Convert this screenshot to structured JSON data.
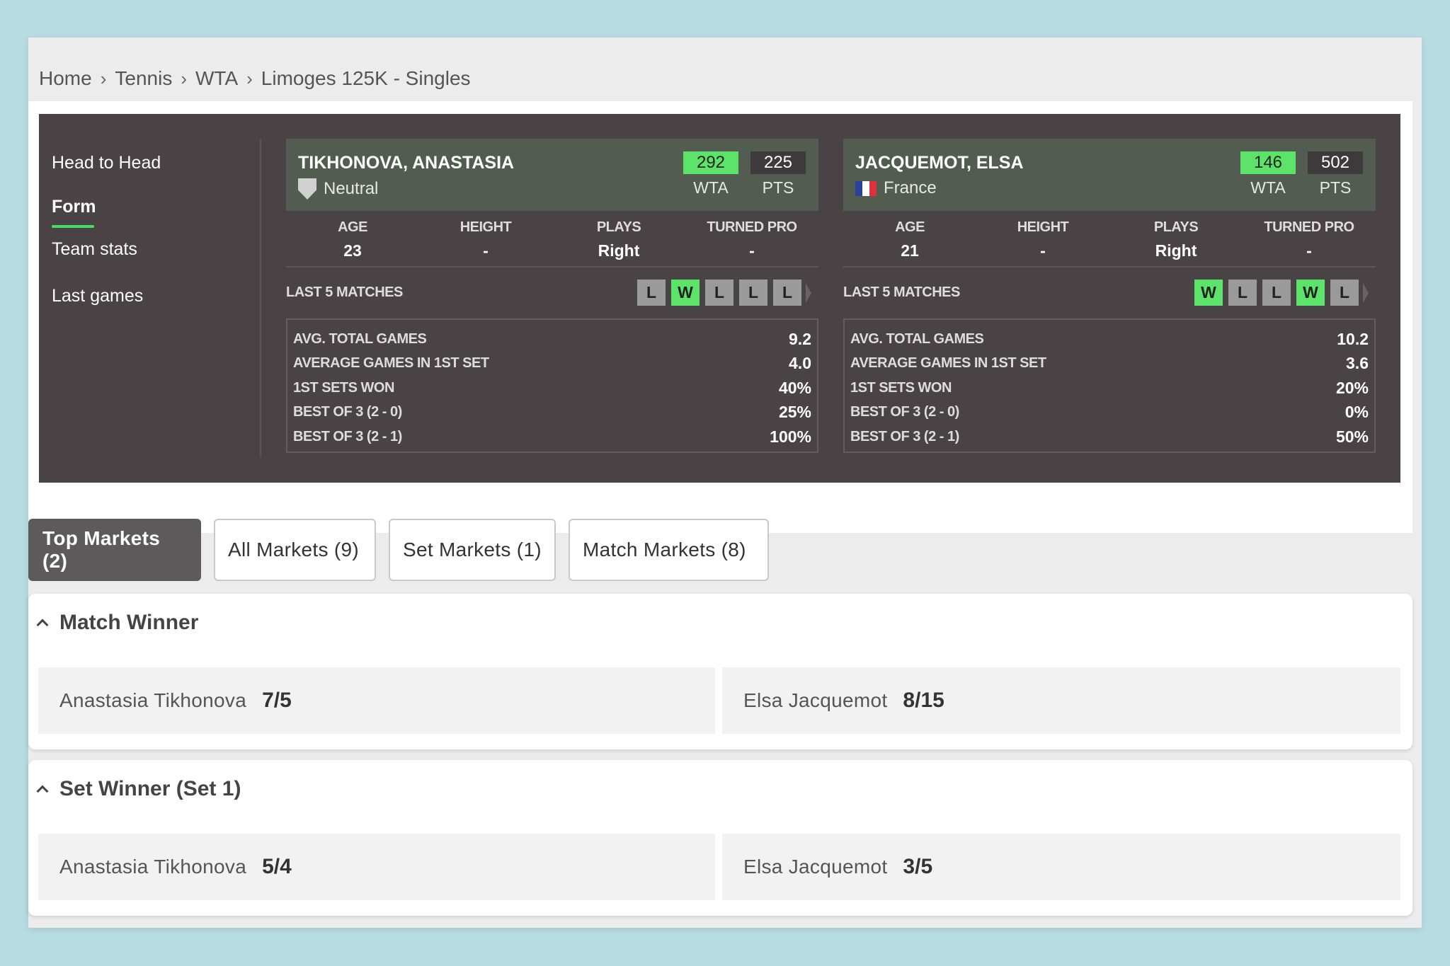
{
  "breadcrumb": [
    "Home",
    "Tennis",
    "WTA",
    "Limoges 125K - Singles"
  ],
  "side_nav": [
    {
      "label": "Head to Head"
    },
    {
      "label": "Form",
      "active": true
    },
    {
      "label": "Team stats"
    },
    {
      "label": "Last games"
    }
  ],
  "players": [
    {
      "name": "TIKHONOVA, ANASTASIA",
      "country": "Neutral",
      "country_icon": "shield-icon",
      "wta_rank": "292",
      "wta_label": "WTA",
      "pts": "225",
      "pts_label": "PTS",
      "info": [
        {
          "label": "AGE",
          "value": "23"
        },
        {
          "label": "HEIGHT",
          "value": "-"
        },
        {
          "label": "PLAYS",
          "value": "Right"
        },
        {
          "label": "TURNED PRO",
          "value": "-"
        }
      ],
      "last5_label": "LAST 5 MATCHES",
      "last5": [
        "L",
        "W",
        "L",
        "L",
        "L"
      ],
      "stats": [
        {
          "label": "AVG. TOTAL GAMES",
          "value": "9.2"
        },
        {
          "label": "AVERAGE GAMES IN 1ST SET",
          "value": "4.0"
        },
        {
          "label": "1ST SETS WON",
          "value": "40%"
        },
        {
          "label": "BEST OF 3 (2 - 0)",
          "value": "25%"
        },
        {
          "label": "BEST OF 3 (2 - 1)",
          "value": "100%"
        }
      ]
    },
    {
      "name": "JACQUEMOT, ELSA",
      "country": "France",
      "country_icon": "france-flag-icon",
      "wta_rank": "146",
      "wta_label": "WTA",
      "pts": "502",
      "pts_label": "PTS",
      "info": [
        {
          "label": "AGE",
          "value": "21"
        },
        {
          "label": "HEIGHT",
          "value": "-"
        },
        {
          "label": "PLAYS",
          "value": "Right"
        },
        {
          "label": "TURNED PRO",
          "value": "-"
        }
      ],
      "last5_label": "LAST 5 MATCHES",
      "last5": [
        "W",
        "L",
        "L",
        "W",
        "L"
      ],
      "stats": [
        {
          "label": "AVG. TOTAL GAMES",
          "value": "10.2"
        },
        {
          "label": "AVERAGE GAMES IN 1ST SET",
          "value": "3.6"
        },
        {
          "label": "1ST SETS WON",
          "value": "20%"
        },
        {
          "label": "BEST OF 3 (2 - 0)",
          "value": "0%"
        },
        {
          "label": "BEST OF 3 (2 - 1)",
          "value": "50%"
        }
      ]
    }
  ],
  "tabs": [
    {
      "label": "Top Markets (2)",
      "active": true
    },
    {
      "label": "All Markets (9)"
    },
    {
      "label": "Set Markets (1)"
    },
    {
      "label": "Match Markets (8)"
    }
  ],
  "markets": [
    {
      "title": "Match Winner",
      "selections": [
        {
          "name": "Anastasia Tikhonova",
          "price": "7/5"
        },
        {
          "name": "Elsa Jacquemot",
          "price": "8/15"
        }
      ]
    },
    {
      "title": "Set Winner (Set 1)",
      "selections": [
        {
          "name": "Anastasia Tikhonova",
          "price": "5/4"
        },
        {
          "name": "Elsa Jacquemot",
          "price": "3/5"
        }
      ]
    }
  ],
  "colors": {
    "panel_bg": "#4a4346",
    "header_bg": "#535c51",
    "win_green": "#5be36a",
    "loss_grey": "#9a9a9a",
    "active_tab": "#5d5a5b"
  }
}
